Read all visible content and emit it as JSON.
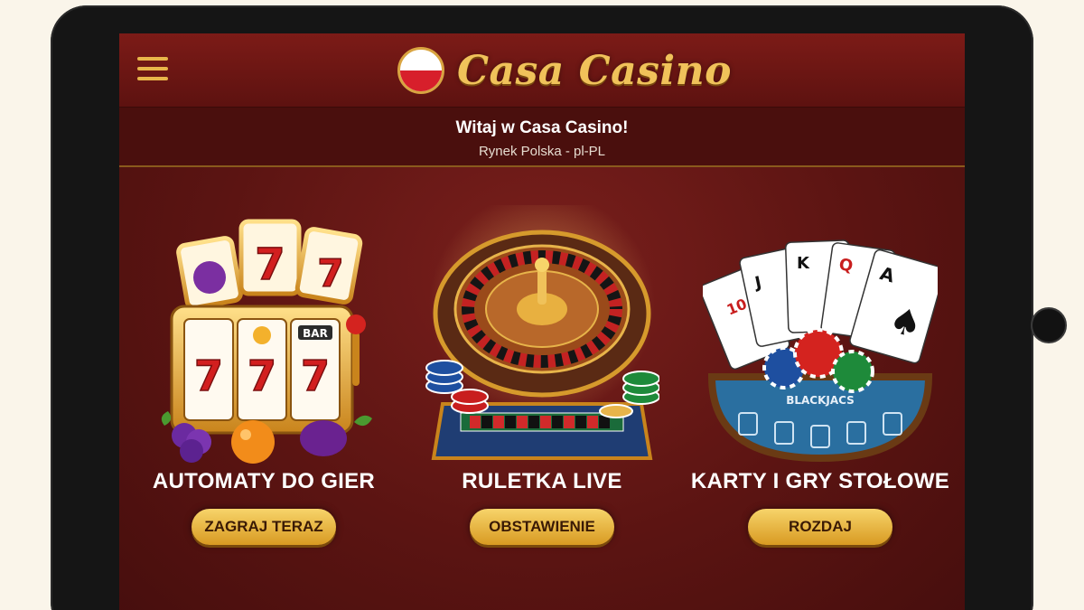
{
  "header": {
    "brand": "Casa Casino"
  },
  "welcome": {
    "title": "Witaj w Casa Casino!",
    "subtitle": "Rynek Polska - pl-PL"
  },
  "games": [
    {
      "title": "AUTOMATY DO GIER",
      "button": "ZAGRAJ TERAZ",
      "icon": "slot-machine-icon",
      "reel_symbols": [
        "7",
        "7",
        "7",
        "BAR"
      ]
    },
    {
      "title": "RULETKA LIVE",
      "button": "OBSTAWIENIE",
      "icon": "roulette-wheel-icon"
    },
    {
      "title": "KARTY I GRY STOŁOWE",
      "button": "ROZDAJ",
      "icon": "playing-cards-icon",
      "card_ranks": [
        "10",
        "J",
        "K",
        "Q",
        "A"
      ],
      "table_text": "BLACKJACS"
    }
  ],
  "colors": {
    "accent": "#f0c25a",
    "background": "#5b1412",
    "button": "#e8b040"
  }
}
